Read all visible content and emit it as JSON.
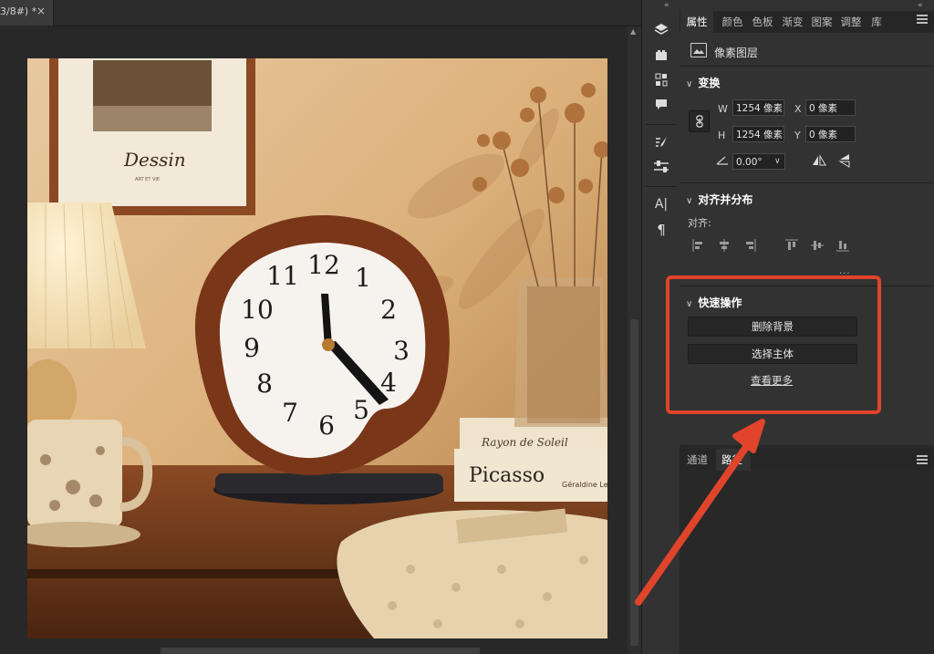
{
  "document": {
    "tab_label": "3/8#) *",
    "close_glyph": "×"
  },
  "toolstrip": {
    "collapse_glyph": "«",
    "tools": [
      "layers-icon",
      "libraries-icon",
      "adjustments-icon",
      "comments-icon",
      "brush-settings-icon",
      "properties-sliders-icon",
      "character-icon",
      "paragraph-icon"
    ],
    "character_glyph": "A|",
    "paragraph_glyph": "¶"
  },
  "panel": {
    "collapse_glyph": "«",
    "tabs": [
      {
        "label": "属性",
        "active": true
      },
      {
        "label": "颜色",
        "active": false
      },
      {
        "label": "色板",
        "active": false
      },
      {
        "label": "渐变",
        "active": false
      },
      {
        "label": "图案",
        "active": false
      },
      {
        "label": "调整",
        "active": false
      },
      {
        "label": "库",
        "active": false
      }
    ],
    "layer_type": "像素图层",
    "transform": {
      "title": "变换",
      "w_label": "W",
      "w_value": "1254 像素",
      "x_label": "X",
      "x_value": "0 像素",
      "h_label": "H",
      "h_value": "1254 像素",
      "y_label": "Y",
      "y_value": "0 像素",
      "angle_value": "0.00°"
    },
    "align": {
      "title": "对齐并分布",
      "sub_label": "对齐:",
      "more": "..."
    },
    "quick_actions": {
      "title": "快速操作",
      "remove_bg": "删除背景",
      "select_subject": "选择主体",
      "see_more": "查看更多"
    },
    "bottom_tabs": [
      {
        "label": "通道",
        "active": false
      },
      {
        "label": "路径",
        "active": true
      }
    ]
  },
  "photo": {
    "frame_text": "Dessin",
    "frame_subtext": "ART ET VIE",
    "clock_numbers": [
      "12",
      "1",
      "2",
      "3",
      "4",
      "5",
      "6",
      "7",
      "8",
      "9",
      "10",
      "11"
    ],
    "book_top": "Rayon de Soleil",
    "book_bottom": "Picasso",
    "book_bottom_author": "Géraldine Le"
  },
  "colors": {
    "highlight": "#e0442b",
    "panel_bg": "#323232",
    "accent_text": "#ffffff"
  }
}
